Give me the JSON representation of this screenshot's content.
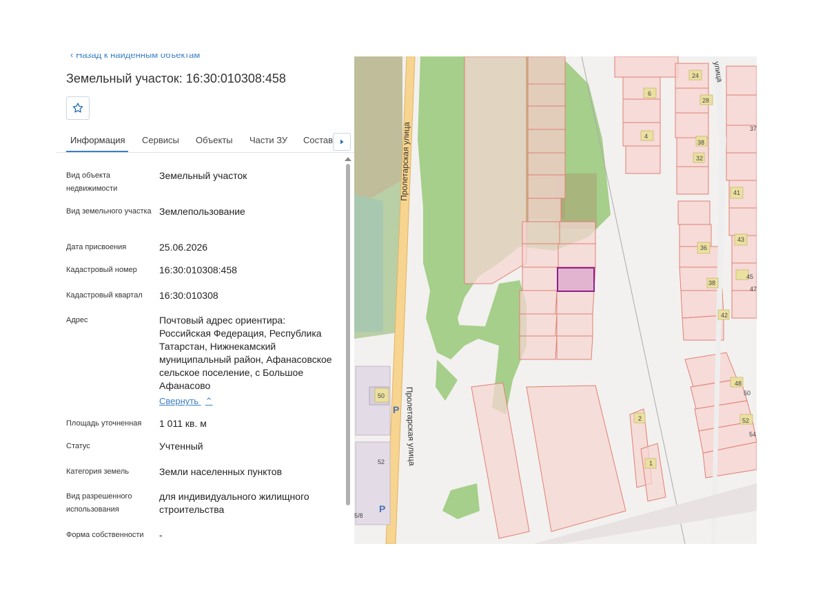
{
  "panel": {
    "back_link": "Назад к найденным объектам",
    "title": "Земельный участок: 16:30:010308:458",
    "favorite_icon": "star-icon",
    "tabs": [
      {
        "label": "Информация",
        "active": true
      },
      {
        "label": "Сервисы",
        "active": false
      },
      {
        "label": "Объекты",
        "active": false
      },
      {
        "label": "Части ЗУ",
        "active": false
      },
      {
        "label": "Состав",
        "active": false
      }
    ],
    "tabs_scroll_icon": "chevron-right-icon",
    "fields": [
      {
        "label": "Вид объекта недвижимости",
        "value": "Земельный участок"
      },
      {
        "label": "Вид земельного участка",
        "value": "Землепользование"
      },
      {
        "label": "Дата присвоения",
        "value": "25.06.2026"
      },
      {
        "label": "Кадастровый номер",
        "value": "16:30:010308:458"
      },
      {
        "label": "Кадастровый квартал",
        "value": "16:30:010308"
      },
      {
        "label": "Адрес",
        "value": "Почтовый адрес ориентира: Российская Федерация, Республика Татарстан, Нижнекамский муниципальный район, Афанасовское сельское поселение, с Большое Афанасово"
      },
      {
        "label": "Площадь уточненная",
        "value": "1 011 кв. м"
      },
      {
        "label": "Статус",
        "value": "Учтенный"
      },
      {
        "label": "Категория земель",
        "value": "Земли населенных пунктов"
      },
      {
        "label": "Вид разрешенного использования",
        "value": "для индивидуального жилищного строительства"
      },
      {
        "label": "Форма собственности",
        "value": "-"
      }
    ],
    "collapse_label": "Свернуть",
    "collapse_icon": "chevron-up-icon"
  },
  "map": {
    "street_labels": [
      "Пролетарская улица",
      "Пролетарская улица",
      "улица"
    ],
    "house_numbers": [
      "24",
      "28",
      "6",
      "4",
      "38",
      "32",
      "41",
      "43",
      "36",
      "38",
      "45",
      "42",
      "48",
      "50",
      "52",
      "54",
      "2",
      "1",
      "50",
      "52",
      "47",
      "37",
      "5/8"
    ],
    "parking_label": "P",
    "colors": {
      "background": "#f2f1ef",
      "forest": "#a5cf8a",
      "parcel_fill": "#f6d6d2",
      "parcel_stroke": "#e07f73",
      "road": "#f7d48f",
      "selected_fill": "#e3b4cf",
      "selected_stroke": "#8c1f8f",
      "building": "#ebe0a0"
    }
  }
}
